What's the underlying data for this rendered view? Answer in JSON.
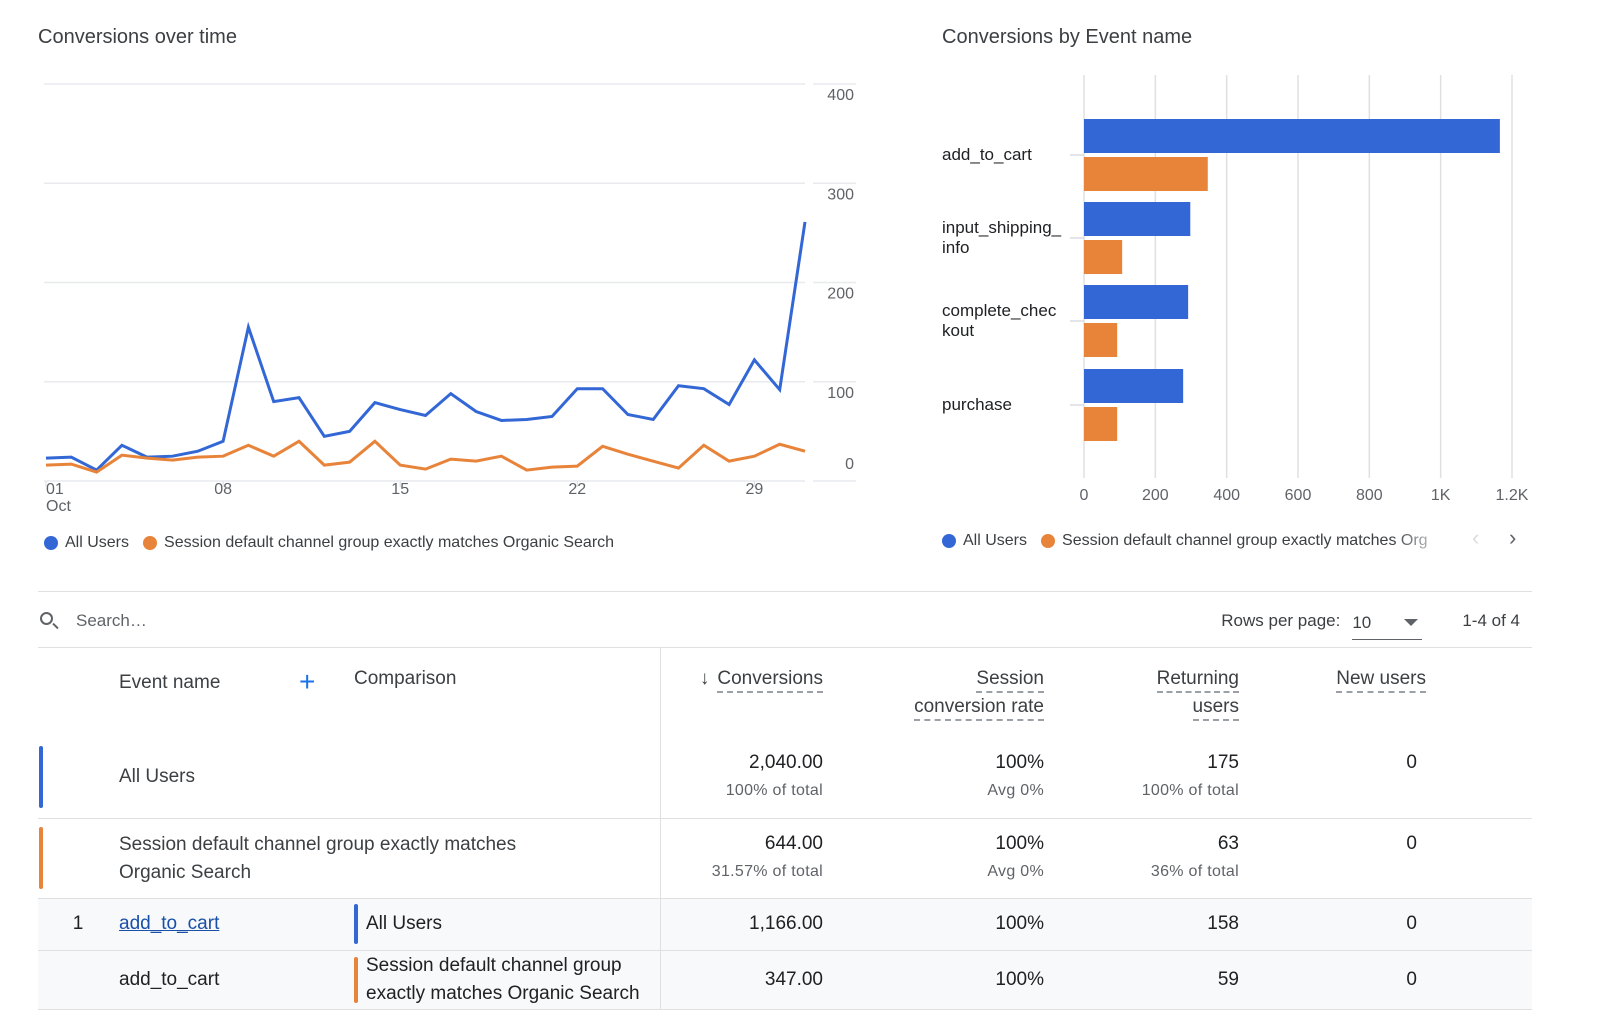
{
  "colors": {
    "all_users": "#3367d6",
    "organic": "#e8833a",
    "grid": "#e8eaed"
  },
  "line_card": {
    "title": "Conversions over time"
  },
  "bar_card": {
    "title": "Conversions by Event name"
  },
  "legend": {
    "all_users": "All Users",
    "organic": "Session default channel group exactly matches Organic Search",
    "organic_truncated": "Session default channel group exactly matches Org",
    "prev_icon": "chevron-left-icon",
    "next_icon": "chevron-right-icon"
  },
  "chart_data": [
    {
      "type": "line",
      "title": "Conversions over time",
      "xlabel": "",
      "ylabel": "",
      "x": [
        1,
        2,
        3,
        4,
        5,
        6,
        7,
        8,
        9,
        10,
        11,
        12,
        13,
        14,
        15,
        16,
        17,
        18,
        19,
        20,
        21,
        22,
        23,
        24,
        25,
        26,
        27,
        28,
        29,
        30,
        31
      ],
      "x_ticks": [
        {
          "day": 1,
          "label": "01",
          "sublabel": "Oct"
        },
        {
          "day": 8,
          "label": "08"
        },
        {
          "day": 15,
          "label": "15"
        },
        {
          "day": 22,
          "label": "22"
        },
        {
          "day": 29,
          "label": "29"
        }
      ],
      "y_ticks": [
        0,
        100,
        200,
        300,
        400
      ],
      "ylim": [
        0,
        400
      ],
      "y_axis_side": "right",
      "grid": true,
      "legend": "bottom-left",
      "series": [
        {
          "name": "All Users",
          "color": "#3367d6",
          "values": [
            23,
            24,
            11,
            36,
            24,
            25,
            30,
            40,
            155,
            80,
            84,
            45,
            50,
            79,
            72,
            66,
            88,
            70,
            61,
            62,
            65,
            93,
            93,
            67,
            62,
            96,
            93,
            77,
            122,
            92,
            261
          ]
        },
        {
          "name": "Session default channel group exactly matches Organic Search",
          "color": "#e8833a",
          "values": [
            16,
            17,
            9,
            26,
            23,
            21,
            24,
            25,
            36,
            25,
            40,
            16,
            19,
            40,
            16,
            12,
            22,
            20,
            25,
            11,
            14,
            15,
            35,
            27,
            20,
            13,
            36,
            20,
            25,
            37,
            30
          ]
        }
      ]
    },
    {
      "type": "bar",
      "orientation": "horizontal",
      "title": "Conversions by Event name",
      "categories": [
        "add_to_cart",
        "input_shipping_info",
        "complete_checkout",
        "purchase"
      ],
      "category_labels": [
        [
          "add_to_cart"
        ],
        [
          "input_shipping_",
          "info"
        ],
        [
          "complete_chec",
          "kout"
        ],
        [
          "purchase"
        ]
      ],
      "x_ticks": [
        {
          "value": 0,
          "label": "0"
        },
        {
          "value": 200,
          "label": "200"
        },
        {
          "value": 400,
          "label": "400"
        },
        {
          "value": 600,
          "label": "600"
        },
        {
          "value": 800,
          "label": "800"
        },
        {
          "value": 1000,
          "label": "1K"
        },
        {
          "value": 1200,
          "label": "1.2K"
        }
      ],
      "xlim": [
        0,
        1200
      ],
      "grid": true,
      "legend": "bottom-left",
      "series": [
        {
          "name": "All Users",
          "color": "#3367d6",
          "values": [
            1166,
            298,
            292,
            278
          ]
        },
        {
          "name": "Session default channel group exactly matches Organic Search",
          "color": "#e8833a",
          "values": [
            347,
            107,
            93,
            93
          ]
        }
      ]
    }
  ],
  "table": {
    "search_placeholder": "Search…",
    "rows_per_page_label": "Rows per page:",
    "rows_per_page_value": "10",
    "range": "1-4 of 4",
    "headers": {
      "event_name": "Event name",
      "add_dimension": "+",
      "comparison": "Comparison",
      "sort_arrow": "↓",
      "conversions": "Conversions",
      "session_rate_1": "Session",
      "session_rate_2": "conversion rate",
      "returning_1": "Returning",
      "returning_2": "users",
      "new_users": "New users"
    },
    "totals": [
      {
        "label": "All Users",
        "color": "#3367d6",
        "conversions": "2,040.00",
        "conversions_sub": "100% of total",
        "rate": "100%",
        "rate_sub": "Avg 0%",
        "returning": "175",
        "returning_sub": "100% of total",
        "new_users": "0"
      },
      {
        "label_1": "Session default channel group exactly matches",
        "label_2": "Organic Search",
        "color": "#e8833a",
        "conversions": "644.00",
        "conversions_sub": "31.57% of total",
        "rate": "100%",
        "rate_sub": "Avg 0%",
        "returning": "63",
        "returning_sub": "36% of total",
        "new_users": "0"
      }
    ],
    "rows": [
      {
        "index": "1",
        "event": "add_to_cart",
        "comparison": "All Users",
        "color": "#3367d6",
        "conversions": "1,166.00",
        "rate": "100%",
        "returning": "158",
        "new_users": "0"
      },
      {
        "index": "",
        "event": "add_to_cart",
        "comparison_1": "Session default channel group",
        "comparison_2": "exactly matches Organic Search",
        "color": "#e8833a",
        "conversions": "347.00",
        "rate": "100%",
        "returning": "59",
        "new_users": "0"
      }
    ]
  }
}
